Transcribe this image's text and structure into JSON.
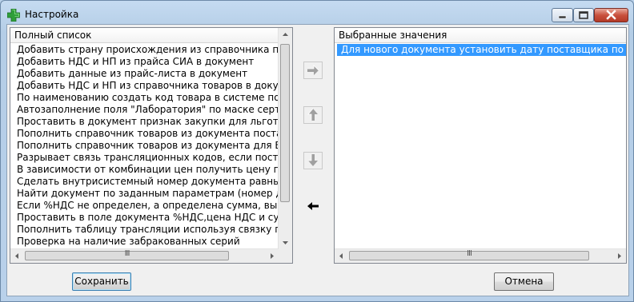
{
  "window": {
    "title": "Настройка",
    "icons": {
      "app": "green-plus-icon",
      "minimize": "minimize-icon",
      "maximize": "maximize-icon",
      "close": "close-icon"
    }
  },
  "full_list": {
    "header": "Полный список",
    "items": [
      "Добавить страну происхождения из справочника поставщика",
      "Добавить НДС и НП из прайса СИА в документ",
      "Добавить данные из прайс-листа в документ",
      "Добавить НДС и НП из справочника товаров в документ",
      "По наименованию создать код товара в системе поставщика",
      "Автозаполнение поля \"Лаборатория\" по маске сертификата",
      "Проставить в документ признак закупки для льготных рецептов",
      "Пополнить справочник товаров из документа поставщика",
      "Пополнить справочник товаров из документа для Балчуга",
      "Разрывает связь трансляционных кодов, если поставщик",
      "В зависимости от комбинации цен получить цену производителя",
      "Сделать внутрисистемный номер документа равным номеру",
      " Найти документ по заданным параметрам (номер док-та",
      "Если %НДС не определен, а определена сумма, вычислить",
      "Проставить в поле документа %НДС,цена НДС и сум.НДС",
      "Пополнить таблицу трансляции используя связку по заводу",
      "Проверка на наличие забракованных серий"
    ]
  },
  "selected_list": {
    "header": "Выбранные значения",
    "items": [
      "Для нового документа установить дату поставщика по запросу"
    ],
    "selected_index": 0
  },
  "scrollbar": {
    "grip": "III",
    "icons": {
      "up": "scroll-up-arrow-icon",
      "down": "scroll-down-arrow-icon",
      "left": "scroll-left-arrow-icon",
      "right": "scroll-right-arrow-icon"
    }
  },
  "transfer_buttons": [
    {
      "name": "move-right-button",
      "icon": "arrow-right-icon",
      "enabled": false
    },
    {
      "name": "move-up-button",
      "icon": "arrow-up-icon",
      "enabled": false
    },
    {
      "name": "move-down-button",
      "icon": "arrow-down-icon",
      "enabled": false
    },
    {
      "name": "move-left-button",
      "icon": "arrow-left-icon",
      "enabled": true
    }
  ],
  "buttons": {
    "save": "Сохранить",
    "cancel": "Отмена"
  },
  "colors": {
    "selection": "#3399ff",
    "window_frame": "#b9d1ea",
    "disabled_arrow": "#a0a0a0",
    "enabled_arrow": "#000000"
  }
}
